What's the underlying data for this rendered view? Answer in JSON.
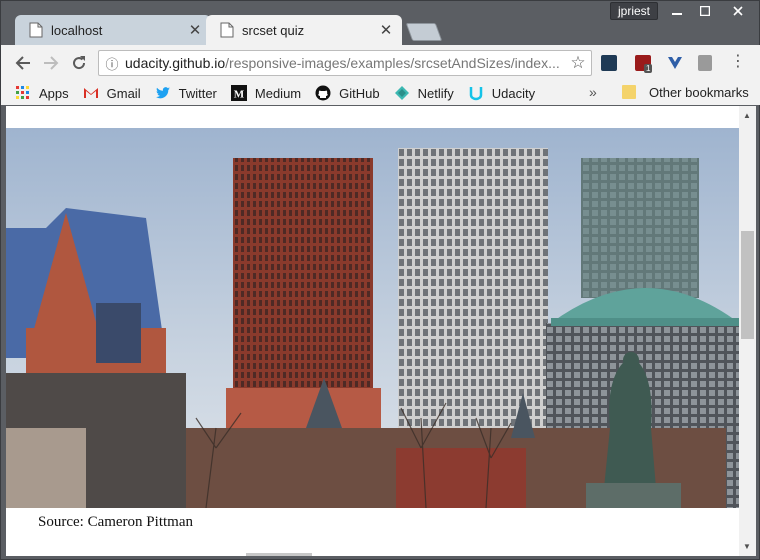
{
  "window": {
    "user": "jpriest",
    "buttons": {
      "minimize": "▁",
      "maximize": "☐",
      "close": "✕"
    }
  },
  "tabs": [
    {
      "label": "localhost",
      "active": false
    },
    {
      "label": "srcset quiz",
      "active": true
    }
  ],
  "toolbar": {
    "url_host": "udacity.github.io",
    "url_path": "/responsive-images/examples/srcsetAndSizes/index...",
    "ext_badge_count": "1"
  },
  "bookmarks": {
    "items": [
      {
        "label": "Apps",
        "icon": "apps-grid-icon"
      },
      {
        "label": "Gmail",
        "icon": "gmail-icon"
      },
      {
        "label": "Twitter",
        "icon": "twitter-icon"
      },
      {
        "label": "Medium",
        "icon": "medium-icon"
      },
      {
        "label": "GitHub",
        "icon": "github-icon"
      },
      {
        "label": "Netlify",
        "icon": "netlify-icon"
      },
      {
        "label": "Udacity",
        "icon": "udacity-icon"
      }
    ],
    "overflow": "»",
    "other": "Other bookmarks"
  },
  "content": {
    "caption": "Source: Cameron Pittman"
  }
}
